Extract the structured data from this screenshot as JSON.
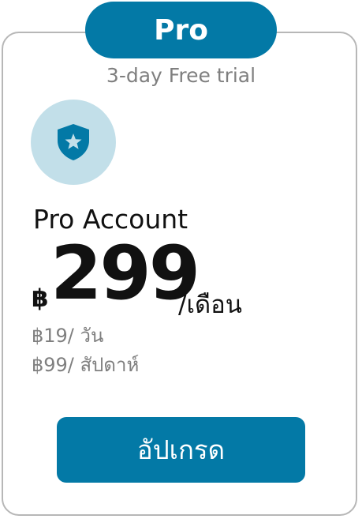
{
  "plan": {
    "name": "Pro",
    "trial": "3-day Free trial",
    "account_name": "Pro Account",
    "price": {
      "currency": "฿",
      "amount": "299",
      "period": "/เดือน"
    },
    "alt_prices": {
      "daily": "฿19/ วัน",
      "weekly": "฿99/ สัปดาห์"
    },
    "badge_icon": "shield-star-icon"
  },
  "actions": {
    "upgrade_label": "อัปเกรด"
  },
  "colors": {
    "accent": "#0379a6",
    "badge_bg": "#c2dfe9",
    "muted_text": "#7f7f7f",
    "card_border": "#b7b7b7"
  }
}
